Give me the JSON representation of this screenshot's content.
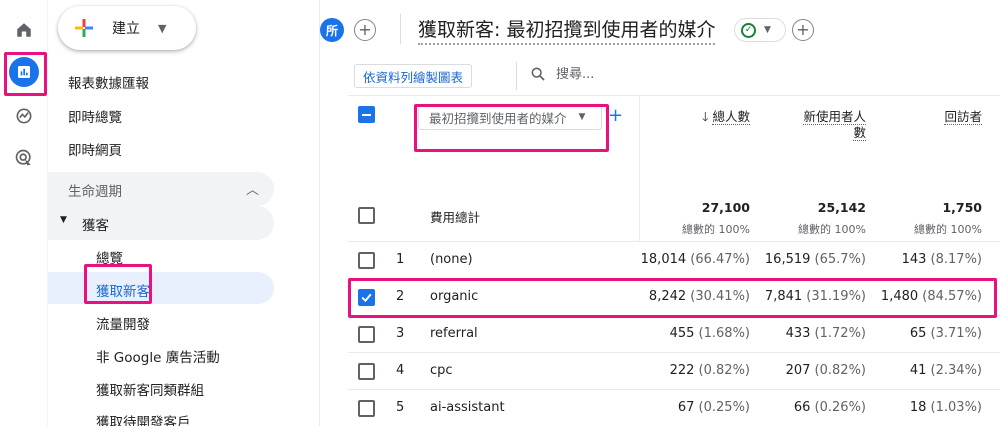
{
  "rail": {
    "items": [
      "home-icon",
      "reports-icon",
      "explore-icon",
      "advertising-icon"
    ]
  },
  "sidebar": {
    "create_label": "建立",
    "items": [
      "報表數據匯報",
      "即時總覽",
      "即時網頁"
    ],
    "section": "生命週期",
    "group": "獲客",
    "sub_items": [
      "總覽",
      "獲取新客",
      "流量開發",
      "非 Google 廣告活動",
      "獲取新客同類群組",
      "獲取待開發客戶"
    ],
    "active": "獲取新客"
  },
  "header": {
    "badge": "所",
    "title": "獲取新客: 最初招攬到使用者的媒介"
  },
  "toolbar": {
    "chart_button": "依資料列繪製圖表",
    "search_placeholder": "搜尋..."
  },
  "table": {
    "dimension_select": "最初招攬到使用者的媒介",
    "columns": [
      {
        "label": "總人數",
        "sorted": "desc"
      },
      {
        "label_line1": "新使用者人",
        "label_line2": "數"
      },
      {
        "label": "回訪者"
      }
    ],
    "totals_label": "費用總計",
    "totals": [
      {
        "value": "27,100",
        "pct": "總數的 100%"
      },
      {
        "value": "25,142",
        "pct": "總數的 100%"
      },
      {
        "value": "1,750",
        "pct": "總數的 100%"
      }
    ],
    "rows": [
      {
        "num": "1",
        "dim": "(none)",
        "v1": "18,014",
        "p1": "(66.47%)",
        "v2": "16,519",
        "p2": "(65.7%)",
        "v3": "143",
        "p3": "(8.17%)",
        "checked": false
      },
      {
        "num": "2",
        "dim": "organic",
        "v1": "8,242",
        "p1": "(30.41%)",
        "v2": "7,841",
        "p2": "(31.19%)",
        "v3": "1,480",
        "p3": "(84.57%)",
        "checked": true
      },
      {
        "num": "3",
        "dim": "referral",
        "v1": "455",
        "p1": "(1.68%)",
        "v2": "433",
        "p2": "(1.72%)",
        "v3": "65",
        "p3": "(3.71%)",
        "checked": false
      },
      {
        "num": "4",
        "dim": "cpc",
        "v1": "222",
        "p1": "(0.82%)",
        "v2": "207",
        "p2": "(0.82%)",
        "v3": "41",
        "p3": "(2.34%)",
        "checked": false
      },
      {
        "num": "5",
        "dim": "ai-assistant",
        "v1": "67",
        "p1": "(0.25%)",
        "v2": "66",
        "p2": "(0.26%)",
        "v3": "18",
        "p3": "(1.03%)",
        "checked": false
      }
    ]
  },
  "colors": {
    "accent": "#1a73e8",
    "highlight": "#e8117f",
    "active_bg": "#e8f0fe"
  }
}
